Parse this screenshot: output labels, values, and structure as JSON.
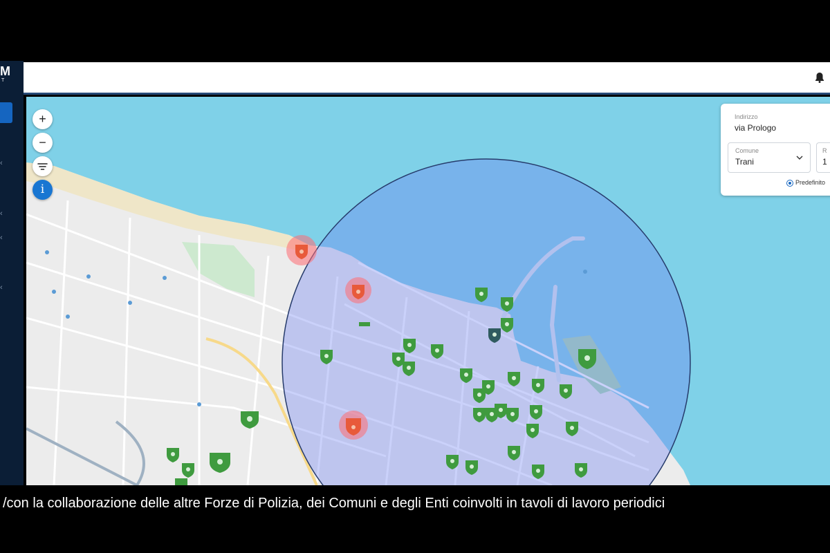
{
  "app": {
    "logo_letter": "M",
    "logo_sub": "T"
  },
  "map": {
    "controls": {
      "zoom_in": "+",
      "zoom_out": "−",
      "info": "i"
    },
    "search_panel": {
      "address_label": "Indirizzo",
      "address_value": "via Prologo",
      "comune_label": "Comune",
      "comune_value": "Trani",
      "raggio_label": "R",
      "raggio_value": "1",
      "radio_label": "Predefinito"
    },
    "colors": {
      "sea": "#7fd1e8",
      "circle": "#8aa6ee",
      "marker_green": "#3f9b3f",
      "marker_red": "#e85a3a"
    },
    "green_markers": 44,
    "red_markers": 3
  },
  "subtitle": "/con la collaborazione delle altre Forze di Polizia, dei Comuni e degli Enti coinvolti in tavoli di lavoro periodici"
}
